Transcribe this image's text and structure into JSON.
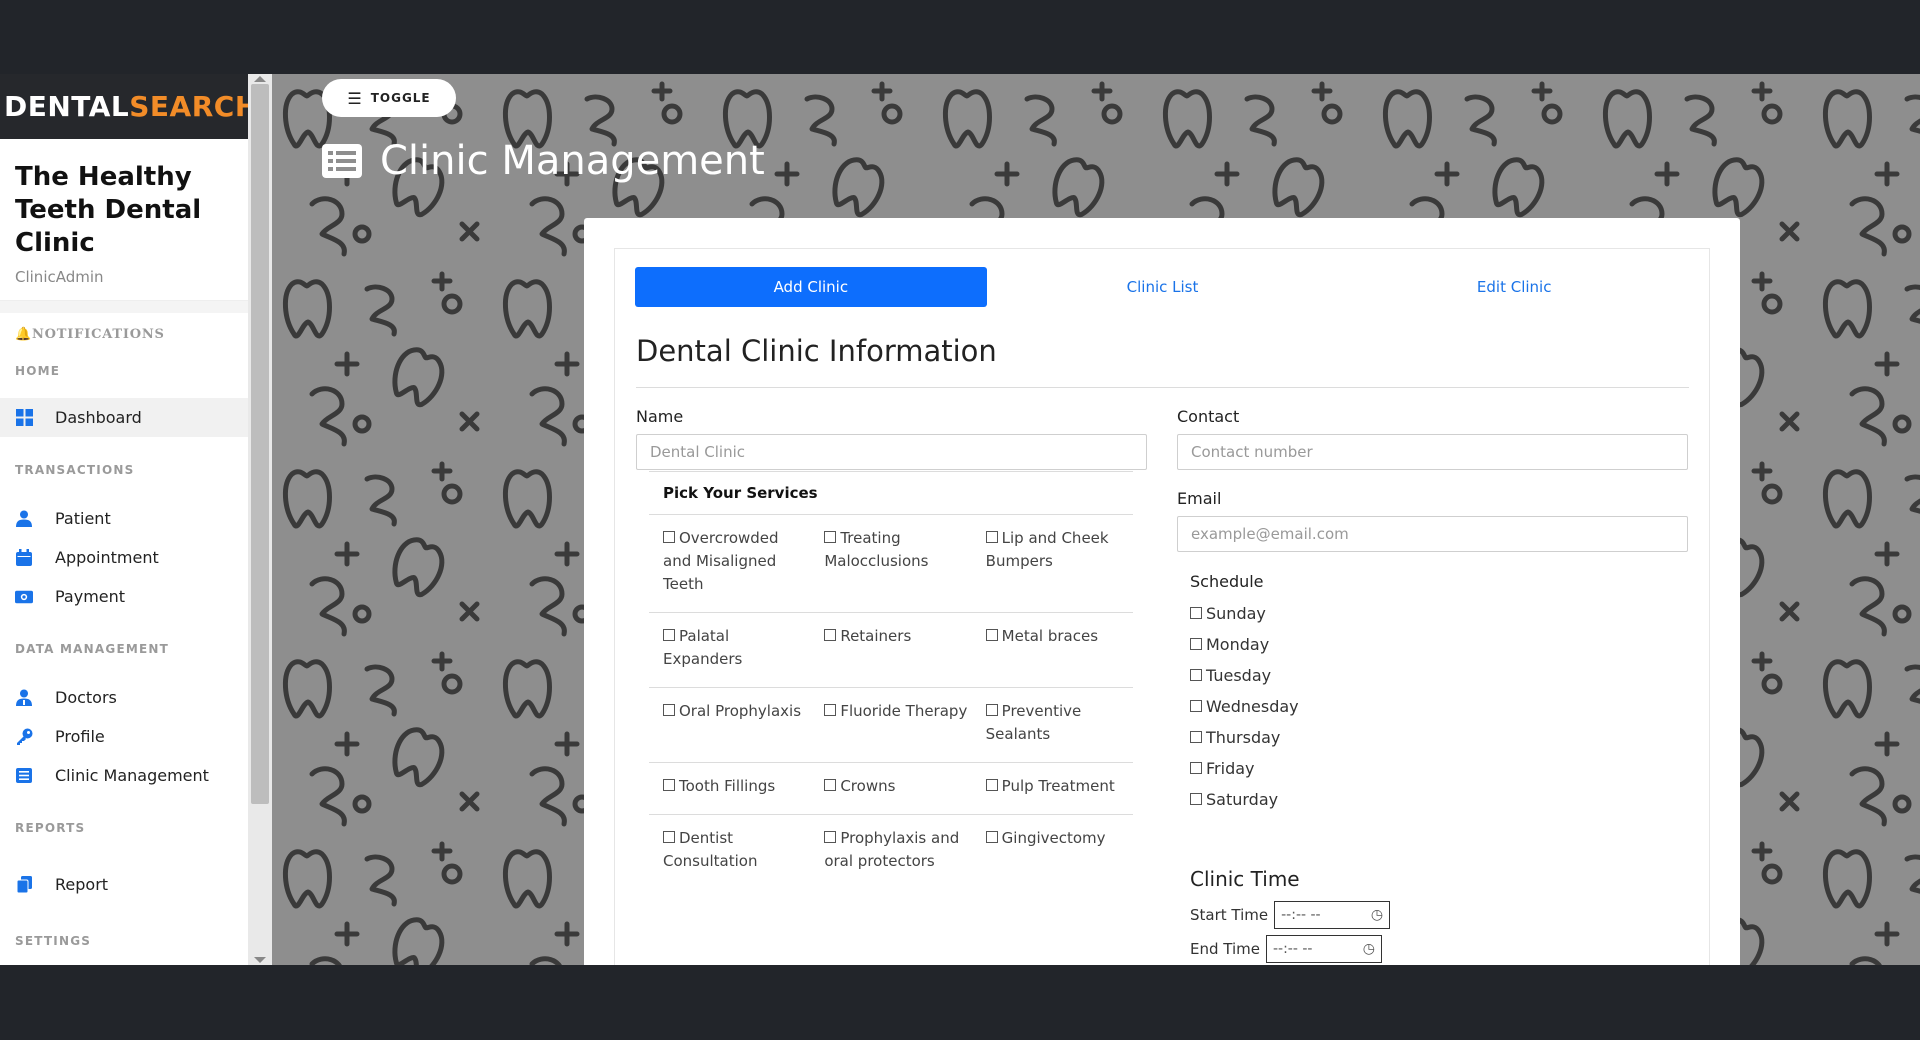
{
  "brand": {
    "part1": "DENTAL",
    "part2": "SEARCH"
  },
  "sidebar": {
    "clinic_name": "The Healthy Teeth Dental Clinic",
    "role": "ClinicAdmin",
    "notifications": "NOTIFICATIONS",
    "sections": {
      "home": "HOME",
      "transactions": "TRANSACTIONS",
      "data_management": "DATA MANAGEMENT",
      "reports": "REPORTS",
      "settings": "SETTINGS"
    },
    "items": {
      "dashboard": "Dashboard",
      "patient": "Patient",
      "appointment": "Appointment",
      "payment": "Payment",
      "doctors": "Doctors",
      "profile": "Profile",
      "clinic_management": "Clinic Management",
      "report": "Report"
    },
    "icon_color": "#1a73e8"
  },
  "toggle": {
    "label": "TOGGLE"
  },
  "page": {
    "title": "Clinic Management"
  },
  "tabs": [
    "Add Clinic",
    "Clinic List",
    "Edit Clinic"
  ],
  "form": {
    "section_title": "Dental Clinic Information",
    "name_label": "Name",
    "name_placeholder": "Dental Clinic",
    "contact_label": "Contact",
    "contact_placeholder": "Contact number",
    "email_label": "Email",
    "email_placeholder": "example@email.com",
    "services_title": "Pick Your Services",
    "services": [
      [
        "Overcrowded and Misaligned Teeth",
        "Treating Malocclusions",
        "Lip and Cheek Bumpers"
      ],
      [
        "Palatal Expanders",
        "Retainers",
        "Metal braces"
      ],
      [
        "Oral Prophylaxis",
        "Fluoride Therapy",
        "Preventive Sealants"
      ],
      [
        "Tooth Fillings",
        "Crowns",
        "Pulp Treatment"
      ],
      [
        "Dentist Consultation",
        "Prophylaxis and oral protectors",
        "Gingivectomy"
      ]
    ],
    "schedule_label": "Schedule",
    "days": [
      "Sunday",
      "Monday",
      "Tuesday",
      "Wednesday",
      "Thursday",
      "Friday",
      "Saturday"
    ],
    "clinic_time_title": "Clinic Time",
    "start_time_label": "Start Time",
    "end_time_label": "End Time",
    "time_placeholder": "--:-- --"
  },
  "colors": {
    "primary": "#0d6efd",
    "brand_accent": "#f28c28",
    "link": "#1a73e8"
  }
}
